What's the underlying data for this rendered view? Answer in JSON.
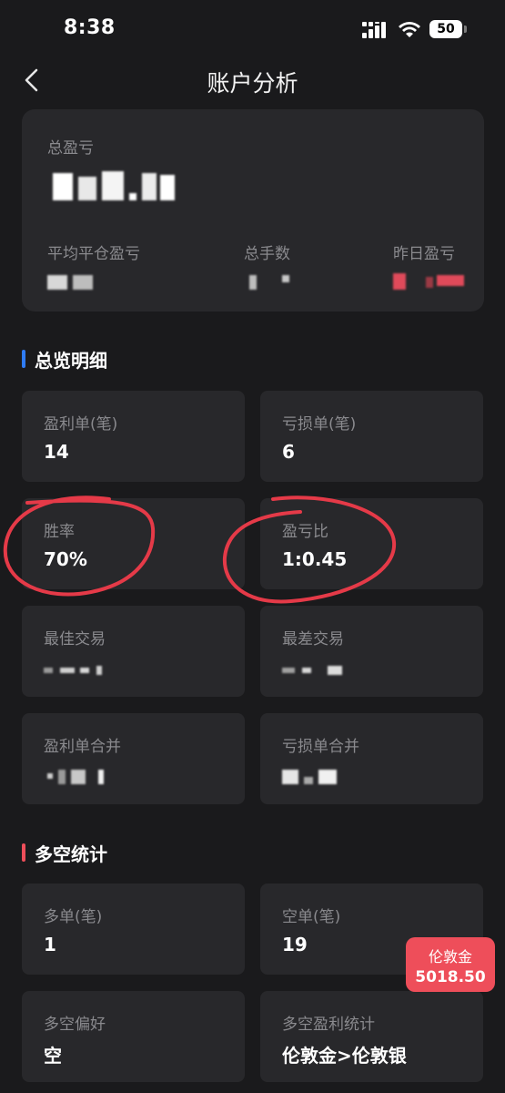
{
  "status_bar": {
    "time": "8:38",
    "battery": "50"
  },
  "nav": {
    "title": "账户分析"
  },
  "summary": {
    "total_pnl_label": "总盈亏",
    "avg_close_pnl_label": "平均平仓盈亏",
    "total_lots_label": "总手数",
    "yesterday_pnl_label": "昨日盈亏"
  },
  "overview": {
    "title": "总览明细",
    "accent_color": "#2f7cf6",
    "items": [
      {
        "label": "盈利单(笔)",
        "value": "14"
      },
      {
        "label": "亏损单(笔)",
        "value": "6"
      },
      {
        "label": "胜率",
        "value": "70%"
      },
      {
        "label": "盈亏比",
        "value": "1:0.45"
      },
      {
        "label": "最佳交易",
        "value": ""
      },
      {
        "label": "最差交易",
        "value": ""
      },
      {
        "label": "盈利单合并",
        "value": ""
      },
      {
        "label": "亏损单合并",
        "value": ""
      }
    ]
  },
  "long_short": {
    "title": "多空统计",
    "accent_color": "#ee4e5a",
    "items": [
      {
        "label": "多单(笔)",
        "value": "1"
      },
      {
        "label": "空单(笔)",
        "value": "19"
      },
      {
        "label": "多空偏好",
        "value": "空"
      },
      {
        "label": "多空盈利统计",
        "value": "伦敦金>伦敦银"
      }
    ]
  },
  "floating_badge": {
    "name": "伦敦金",
    "price": "5018.50",
    "color": "#ee4e5a"
  }
}
